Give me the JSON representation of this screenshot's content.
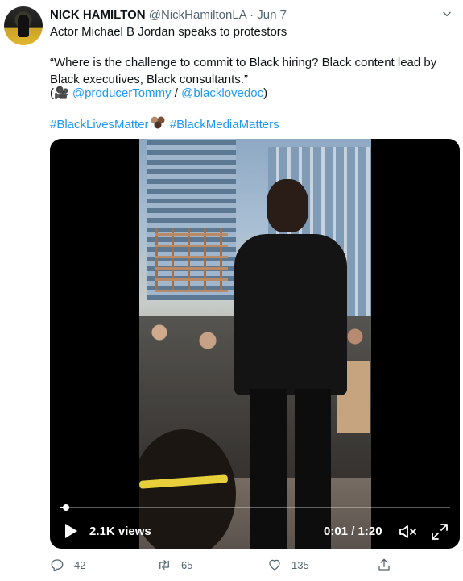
{
  "tweet": {
    "author_name": "NICK HAMILTON",
    "author_handle": "@NickHamiltonLA",
    "separator": "·",
    "date": "Jun 7",
    "line1": "Actor Michael B Jordan speaks to protestors",
    "quote": "“Where is the challenge to commit to Black hiring? Black content lead by Black executives, Black consultants.”",
    "credit_open": "(🎥 ",
    "credit_user1": "@producerTommy",
    "credit_sep": " / ",
    "credit_user2": "@blacklovedoc",
    "credit_close": ")",
    "hashtag1": "#BlackLivesMatter",
    "hashtag2": "#BlackMediaMatters"
  },
  "icons": {
    "menu": "chevron-down-icon",
    "avatar": "avatar",
    "play": "play-icon",
    "mute": "muted-speaker-icon",
    "fullscreen": "fullscreen-icon",
    "reply": "reply-icon",
    "retweet": "retweet-icon",
    "like": "heart-icon",
    "share": "share-icon"
  },
  "video": {
    "views": "2.1K views",
    "time": "0:01 / 1:20",
    "progress": 0.0125
  },
  "actions": {
    "replies": "42",
    "retweets": "65",
    "likes": "135"
  },
  "colors": {
    "link": "#1d9bf0",
    "muted_text": "#536471",
    "text": "#0f1419"
  }
}
